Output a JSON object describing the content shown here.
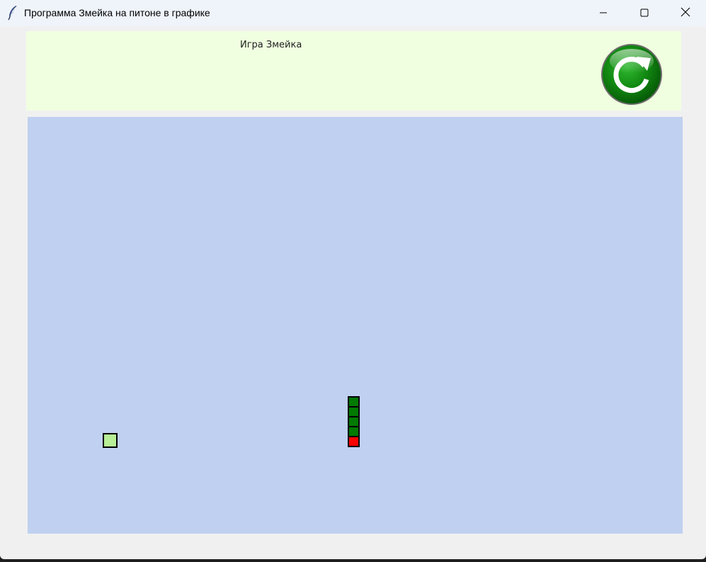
{
  "window": {
    "title": "Программа Змейка на питоне в графике",
    "icon": "feather-icon",
    "controls": {
      "minimize_icon": "minimize-icon",
      "maximize_icon": "maximize-icon",
      "close_icon": "close-icon"
    }
  },
  "header": {
    "title": "Игра Змейка",
    "background": "#f0ffe0",
    "restart_icon": "restart-icon",
    "restart_color": "#128a12"
  },
  "board": {
    "background": "#c0d0f0",
    "food_color": "#b7ee96",
    "snake_body_color": "#007a00",
    "snake_head_color": "#ff0000"
  }
}
